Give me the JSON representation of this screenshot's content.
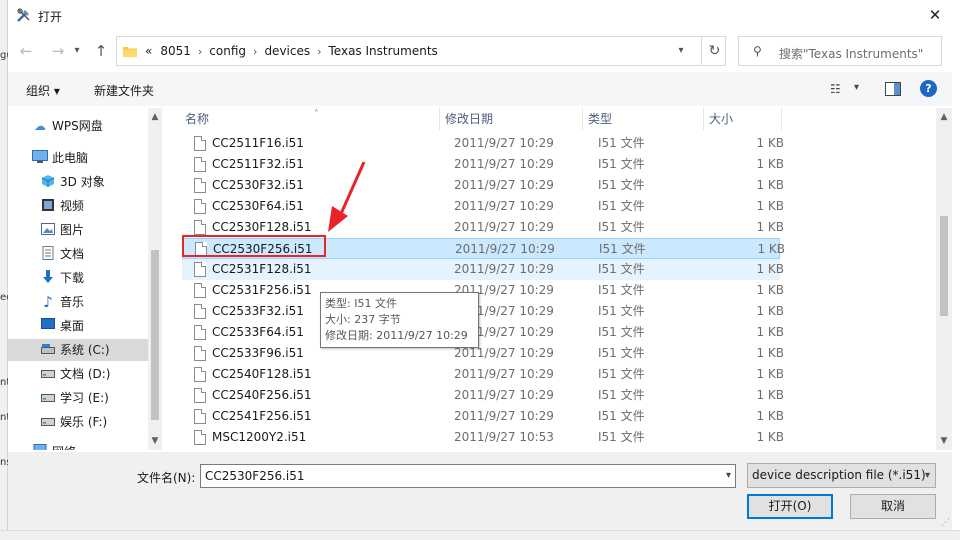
{
  "window": {
    "title": "打开"
  },
  "address": {
    "breadcrumbs": [
      "«",
      "8051",
      "config",
      "devices",
      "Texas Instruments"
    ]
  },
  "search": {
    "placeholder": "搜索\"Texas Instruments\""
  },
  "commandbar": {
    "organize": "组织 ▾",
    "new_folder": "新建文件夹"
  },
  "navpane": {
    "items": [
      {
        "label": "WPS网盘",
        "icon": "cloud-icon",
        "color": "#3c8fd8"
      },
      {
        "label": "此电脑",
        "icon": "computer-icon",
        "color": "#3a86c8"
      },
      {
        "label": "3D 对象",
        "icon": "cube-icon",
        "color": "#3aa0d8"
      },
      {
        "label": "视频",
        "icon": "video-icon",
        "color": "#444444"
      },
      {
        "label": "图片",
        "icon": "pictures-icon",
        "color": "#4c8ac8"
      },
      {
        "label": "文档",
        "icon": "documents-icon",
        "color": "#6a7a8a"
      },
      {
        "label": "下载",
        "icon": "download-icon",
        "color": "#1e6fc8"
      },
      {
        "label": "音乐",
        "icon": "music-icon",
        "color": "#1e6fc8"
      },
      {
        "label": "桌面",
        "icon": "desktop-icon",
        "color": "#1e6fc8"
      },
      {
        "label": "系统 (C:)",
        "icon": "drive-c-icon",
        "color": "#4a4a4a",
        "selected": true
      },
      {
        "label": "文档 (D:)",
        "icon": "drive-icon",
        "color": "#4a4a4a"
      },
      {
        "label": "学习 (E:)",
        "icon": "drive-icon",
        "color": "#4a4a4a"
      },
      {
        "label": "娱乐 (F:)",
        "icon": "drive-icon",
        "color": "#4a4a4a"
      },
      {
        "label": "网络",
        "icon": "network-icon",
        "color": "#3a86c8"
      }
    ]
  },
  "columns": [
    "名称",
    "修改日期",
    "类型",
    "大小"
  ],
  "files": [
    {
      "name": "CC2511F16.i51",
      "date": "2011/9/27 10:29",
      "type": "I51 文件",
      "size": "1 KB"
    },
    {
      "name": "CC2511F32.i51",
      "date": "2011/9/27 10:29",
      "type": "I51 文件",
      "size": "1 KB"
    },
    {
      "name": "CC2530F32.i51",
      "date": "2011/9/27 10:29",
      "type": "I51 文件",
      "size": "1 KB"
    },
    {
      "name": "CC2530F64.i51",
      "date": "2011/9/27 10:29",
      "type": "I51 文件",
      "size": "1 KB"
    },
    {
      "name": "CC2530F128.i51",
      "date": "2011/9/27 10:29",
      "type": "I51 文件",
      "size": "1 KB"
    },
    {
      "name": "CC2530F256.i51",
      "date": "2011/9/27 10:29",
      "type": "I51 文件",
      "size": "1 KB",
      "state": "selected"
    },
    {
      "name": "CC2531F128.i51",
      "date": "2011/9/27 10:29",
      "type": "I51 文件",
      "size": "1 KB",
      "state": "hover"
    },
    {
      "name": "CC2531F256.i51",
      "date": "2011/9/27 10:29",
      "type": "I51 文件",
      "size": "1 KB"
    },
    {
      "name": "CC2533F32.i51",
      "date": "2011/9/27 10:29",
      "type": "I51 文件",
      "size": "1 KB"
    },
    {
      "name": "CC2533F64.i51",
      "date": "2011/9/27 10:29",
      "type": "I51 文件",
      "size": "1 KB"
    },
    {
      "name": "CC2533F96.i51",
      "date": "2011/9/27 10:29",
      "type": "I51 文件",
      "size": "1 KB"
    },
    {
      "name": "CC2540F128.i51",
      "date": "2011/9/27 10:29",
      "type": "I51 文件",
      "size": "1 KB"
    },
    {
      "name": "CC2540F256.i51",
      "date": "2011/9/27 10:29",
      "type": "I51 文件",
      "size": "1 KB"
    },
    {
      "name": "CC2541F256.i51",
      "date": "2011/9/27 10:29",
      "type": "I51 文件",
      "size": "1 KB"
    },
    {
      "name": "MSC1200Y2.i51",
      "date": "2011/9/27 10:53",
      "type": "I51 文件",
      "size": "1 KB"
    }
  ],
  "tooltip": {
    "type_line": "类型: I51 文件",
    "size_line": "大小: 237 字节",
    "date_line": "修改日期: 2011/9/27 10:29"
  },
  "bottom": {
    "filename_label": "文件名(N):",
    "filename_value": "CC2530F256.i51",
    "filter": "device description file (*.i51)",
    "open_button": "打开(O)",
    "cancel_button": "取消"
  },
  "background_window": {
    "fragments": [
      "gu",
      "ec",
      "nt",
      "nt",
      "ns"
    ]
  },
  "colors": {
    "accent": "#0078d7",
    "selection": "#cce8ff",
    "annotation": "#e8232a"
  }
}
